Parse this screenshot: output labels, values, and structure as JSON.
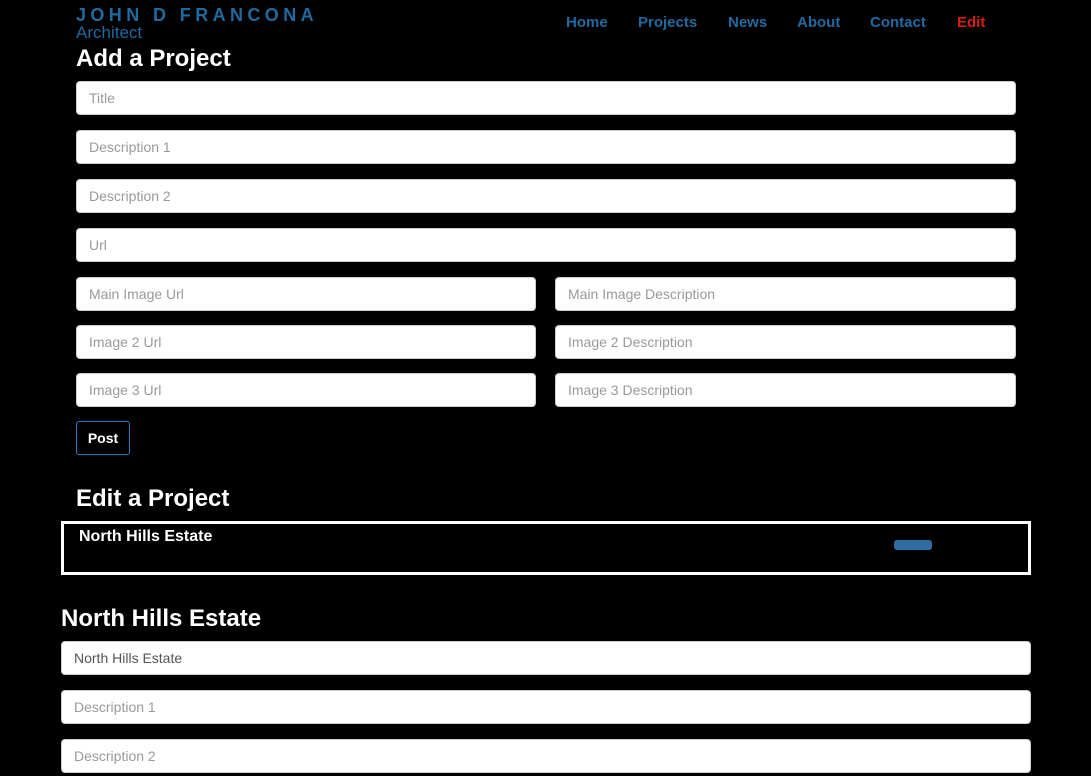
{
  "brand": {
    "name": "JOHN D FRANCONA",
    "subtitle": "Architect"
  },
  "nav": {
    "items": [
      {
        "label": "Home",
        "active": false
      },
      {
        "label": "Projects",
        "active": false
      },
      {
        "label": "News",
        "active": false
      },
      {
        "label": "About",
        "active": false
      },
      {
        "label": "Contact",
        "active": false
      },
      {
        "label": "Edit",
        "active": true
      }
    ]
  },
  "add_project": {
    "heading": "Add a Project",
    "title_placeholder": "Title",
    "description1_placeholder": "Description 1",
    "description2_placeholder": "Description 2",
    "url_placeholder": "Url",
    "main_image_url_placeholder": "Main Image Url",
    "main_image_description_placeholder": "Main Image Description",
    "image2_url_placeholder": "Image 2 Url",
    "image2_description_placeholder": "Image 2 Description",
    "image3_url_placeholder": "Image 3 Url",
    "image3_description_placeholder": "Image 3 Description",
    "post_label": "Post"
  },
  "edit_project": {
    "heading": "Edit a Project",
    "projects": [
      {
        "title": "North Hills Estate"
      }
    ]
  },
  "project_editor": {
    "heading": "North Hills Estate",
    "title_value": "North Hills Estate",
    "description1_placeholder": "Description 1",
    "description2_placeholder": "Description 2"
  },
  "colors": {
    "brand": "#1f6aa0",
    "nav_link": "#1f6aa0",
    "nav_active": "#d81e12",
    "background": "#000000",
    "post_button_border": "#2a7cc7",
    "edit_button": "#2e6da4"
  }
}
